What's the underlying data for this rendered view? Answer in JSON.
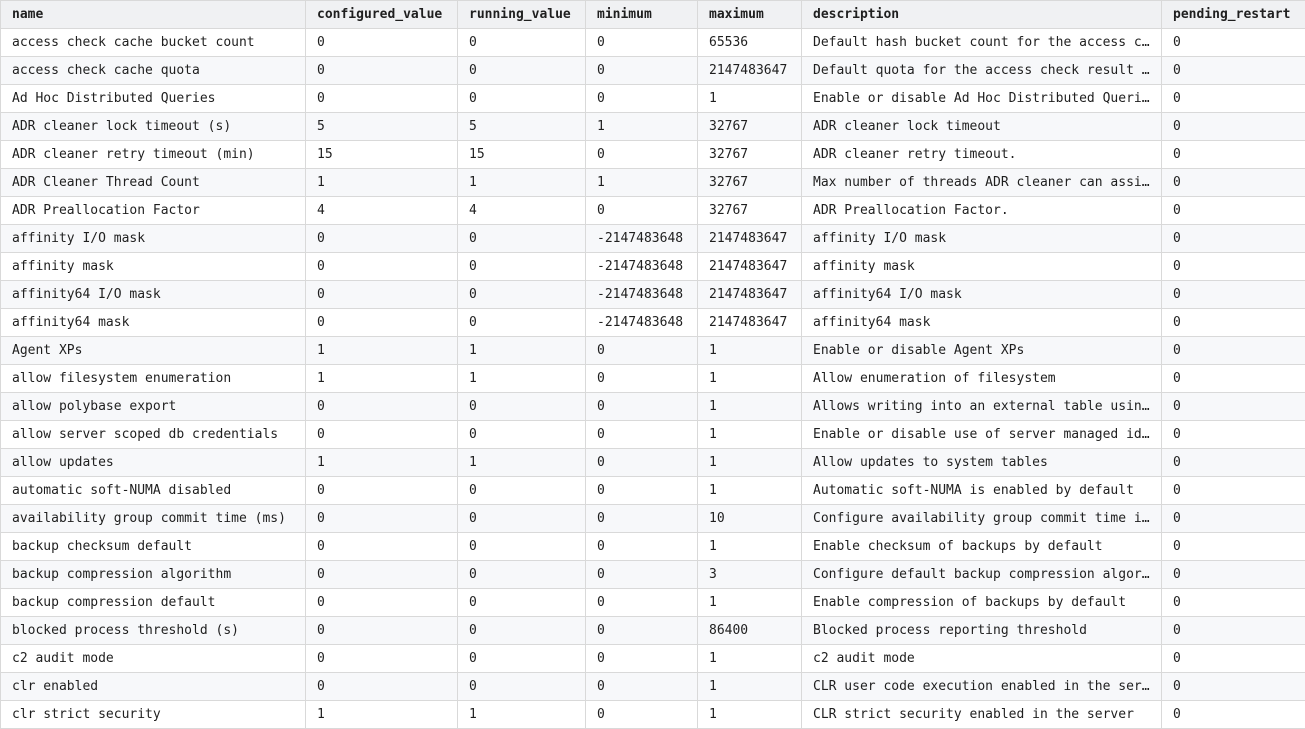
{
  "grid": {
    "columns": [
      "name",
      "configured_value",
      "running_value",
      "minimum",
      "maximum",
      "description",
      "pending_restart"
    ],
    "rows": [
      [
        "access check cache bucket count",
        "0",
        "0",
        "0",
        "65536",
        "Default hash bucket count for the access check result security cache",
        "0"
      ],
      [
        "access check cache quota",
        "0",
        "0",
        "0",
        "2147483647",
        "Default quota for the access check result security cache",
        "0"
      ],
      [
        "Ad Hoc Distributed Queries",
        "0",
        "0",
        "0",
        "1",
        "Enable or disable Ad Hoc Distributed Queries",
        "0"
      ],
      [
        "ADR cleaner lock timeout (s)",
        "5",
        "5",
        "1",
        "32767",
        "ADR cleaner lock timeout",
        "0"
      ],
      [
        "ADR cleaner retry timeout (min)",
        "15",
        "15",
        "0",
        "32767",
        "ADR cleaner retry timeout.",
        "0"
      ],
      [
        "ADR Cleaner Thread Count",
        "1",
        "1",
        "1",
        "32767",
        "Max number of threads ADR cleaner can assign.",
        "0"
      ],
      [
        "ADR Preallocation Factor",
        "4",
        "4",
        "0",
        "32767",
        "ADR Preallocation Factor.",
        "0"
      ],
      [
        "affinity I/O mask",
        "0",
        "0",
        "-2147483648",
        "2147483647",
        "affinity I/O mask",
        "0"
      ],
      [
        "affinity mask",
        "0",
        "0",
        "-2147483648",
        "2147483647",
        "affinity mask",
        "0"
      ],
      [
        "affinity64 I/O mask",
        "0",
        "0",
        "-2147483648",
        "2147483647",
        "affinity64 I/O mask",
        "0"
      ],
      [
        "affinity64 mask",
        "0",
        "0",
        "-2147483648",
        "2147483647",
        "affinity64 mask",
        "0"
      ],
      [
        "Agent XPs",
        "1",
        "1",
        "0",
        "1",
        "Enable or disable Agent XPs",
        "0"
      ],
      [
        "allow filesystem enumeration",
        "1",
        "1",
        "0",
        "1",
        "Allow enumeration of filesystem",
        "0"
      ],
      [
        "allow polybase export",
        "0",
        "0",
        "0",
        "1",
        "Allows writing into an external table using polybase",
        "0"
      ],
      [
        "allow server scoped db credentials",
        "0",
        "0",
        "0",
        "1",
        "Enable or disable use of server managed identity",
        "0"
      ],
      [
        "allow updates",
        "1",
        "1",
        "0",
        "1",
        "Allow updates to system tables",
        "0"
      ],
      [
        "automatic soft-NUMA disabled",
        "0",
        "0",
        "0",
        "1",
        "Automatic soft-NUMA is enabled by default",
        "0"
      ],
      [
        "availability group commit time (ms)",
        "0",
        "0",
        "0",
        "10",
        "Configure availability group commit time in ms",
        "0"
      ],
      [
        "backup checksum default",
        "0",
        "0",
        "0",
        "1",
        "Enable checksum of backups by default",
        "0"
      ],
      [
        "backup compression algorithm",
        "0",
        "0",
        "0",
        "3",
        "Configure default backup compression algorithm",
        "0"
      ],
      [
        "backup compression default",
        "0",
        "0",
        "0",
        "1",
        "Enable compression of backups by default",
        "0"
      ],
      [
        "blocked process threshold (s)",
        "0",
        "0",
        "0",
        "86400",
        "Blocked process reporting threshold",
        "0"
      ],
      [
        "c2 audit mode",
        "0",
        "0",
        "0",
        "1",
        "c2 audit mode",
        "0"
      ],
      [
        "clr enabled",
        "0",
        "0",
        "0",
        "1",
        "CLR user code execution enabled in the server",
        "0"
      ],
      [
        "clr strict security",
        "1",
        "1",
        "0",
        "1",
        "CLR strict security enabled in the server",
        "0"
      ]
    ]
  }
}
